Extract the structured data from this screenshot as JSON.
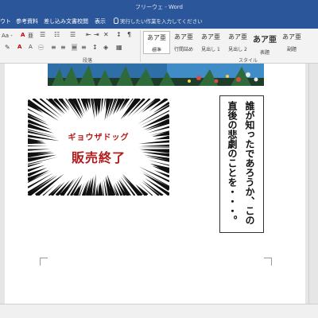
{
  "window": {
    "title": "フリーウェ - Word"
  },
  "tabs": {
    "layout": "ウト",
    "references": "参考資料",
    "mailings": "差し込み文書",
    "review": "校閲",
    "view": "表示",
    "tell_me": "実行したい作業を入力してください"
  },
  "ribbon": {
    "font_size_label": "Aa -",
    "paragraph_group": "段落",
    "styles_group": "スタイル",
    "styles": [
      {
        "sample": "あア亜",
        "name": "標準"
      },
      {
        "sample": "あア亜",
        "name": "行間詰め"
      },
      {
        "sample": "あア亜",
        "name": "見出し 1"
      },
      {
        "sample": "あア亜",
        "name": "見出し 2"
      },
      {
        "sample": "あア亜",
        "name": "表題"
      },
      {
        "sample": "あア亜",
        "name": "副題"
      }
    ]
  },
  "document": {
    "manga_small": "ギョウザドッグ",
    "manga_big": "販売終了",
    "vertical_text": "誰が知ったであろうか、この直後の悲劇のことを・・・。"
  },
  "colors": {
    "ribbon_blue": "#2b579a",
    "accent_red": "#b31b1b"
  }
}
